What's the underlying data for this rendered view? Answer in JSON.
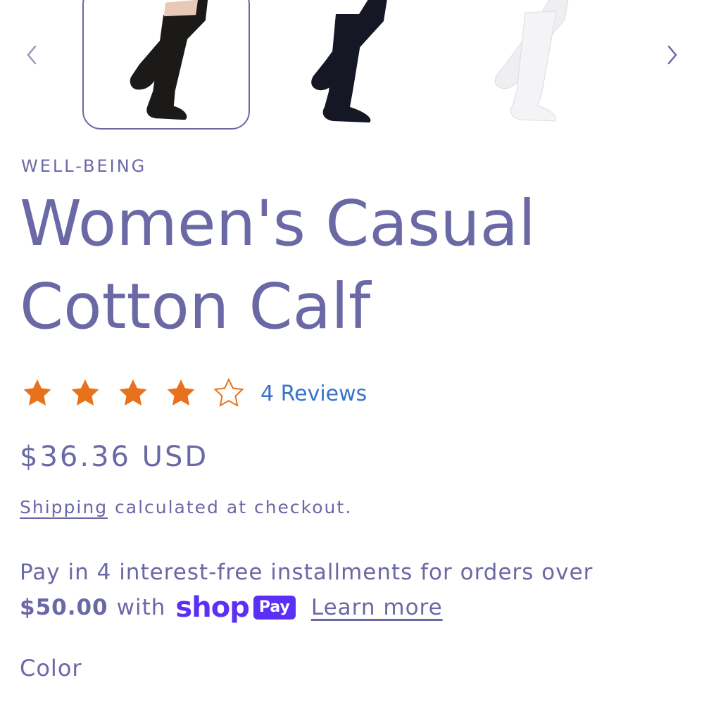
{
  "carousel": {
    "prev_icon": "chevron-left-icon",
    "next_icon": "chevron-right-icon",
    "thumbnails": [
      {
        "name": "black-sock-thumbnail",
        "sock_color": "#1c1a18",
        "selected": true
      },
      {
        "name": "navy-sock-thumbnail",
        "sock_color": "#151725",
        "selected": false
      },
      {
        "name": "white-sock-thumbnail",
        "sock_color": "#f2f2f4",
        "selected": false
      }
    ]
  },
  "product": {
    "vendor": "WELL-BEING",
    "title_line1": "Women's Casual",
    "title_line2": "Cotton Calf",
    "rating": {
      "value": 4,
      "max": 5,
      "reviews_label": "4 Reviews",
      "star_color": "#e8721c"
    },
    "price": "$36.36 USD",
    "shipping": {
      "link_text": "Shipping",
      "rest_text": " calculated at checkout."
    },
    "installments": {
      "line1": "Pay in 4 interest-free installments for orders over",
      "amount": "$50.00",
      "with_text": "with",
      "shop_logo": "shop",
      "pay_badge": "Pay",
      "learn_more": "Learn more"
    },
    "color_label": "Color"
  },
  "colors": {
    "accent": "#6b68a6",
    "link": "#3b73c8",
    "shop_pay": "#5a31f4"
  }
}
